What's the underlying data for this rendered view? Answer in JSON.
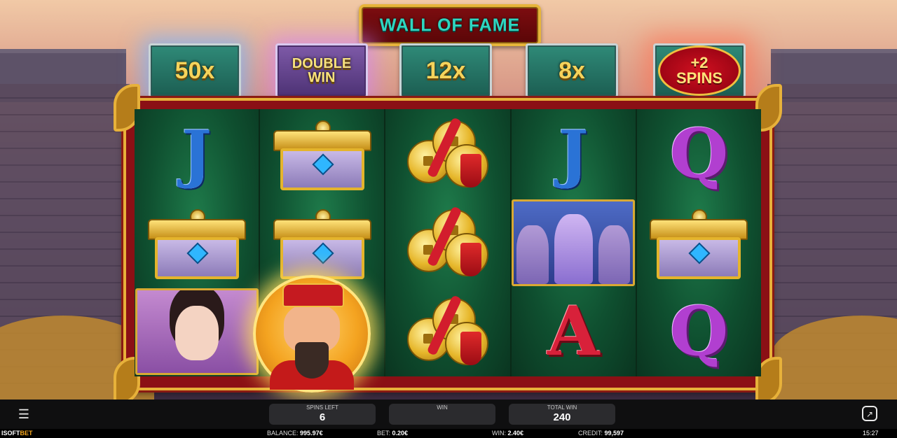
{
  "title": "WALL OF FAME",
  "multipliers": [
    {
      "label": "50x",
      "style": "teal",
      "glow": "blue"
    },
    {
      "label": "DOUBLE WIN",
      "style": "purple",
      "glow": "purple"
    },
    {
      "label": "12x",
      "style": "teal",
      "glow": "none"
    },
    {
      "label": "8x",
      "style": "teal",
      "glow": "none"
    },
    {
      "label": "+2 SPINS",
      "style": "teal",
      "glow": "red"
    }
  ],
  "reels": [
    [
      "J-symbol",
      "golden-chest-symbol",
      "princess-symbol"
    ],
    [
      "golden-chest-symbol",
      "golden-chest-symbol",
      "fortune-god-wild-symbol"
    ],
    [
      "lucky-coins-symbol",
      "lucky-coins-symbol",
      "lucky-coins-symbol"
    ],
    [
      "J-symbol",
      "terracotta-warriors-symbol",
      "A-symbol"
    ],
    [
      "Q-symbol",
      "golden-chest-symbol",
      "Q-symbol"
    ]
  ],
  "symbol_letters": {
    "J": "J",
    "Q": "Q",
    "A": "A"
  },
  "hud": {
    "spins_left_label": "SPINS LEFT",
    "spins_left_value": "6",
    "win_label": "WIN",
    "win_value": "",
    "total_win_label": "TOTAL WIN",
    "total_win_value": "240"
  },
  "footer": {
    "brand_prefix": "ISOFT",
    "brand_suffix": "BET",
    "balance_label": "BALANCE:",
    "balance_value": "995.97€",
    "bet_label": "BET:",
    "bet_value": "0.20€",
    "win_label": "WIN:",
    "win_value": "2.40€",
    "credit_label": "CREDIT:",
    "credit_value": "99,597",
    "clock": "15:27"
  },
  "colors": {
    "frame_gold": "#e7b13a",
    "frame_red": "#8b1015",
    "reel_green": "#0f5030",
    "brand_orange": "#f3a51c"
  }
}
